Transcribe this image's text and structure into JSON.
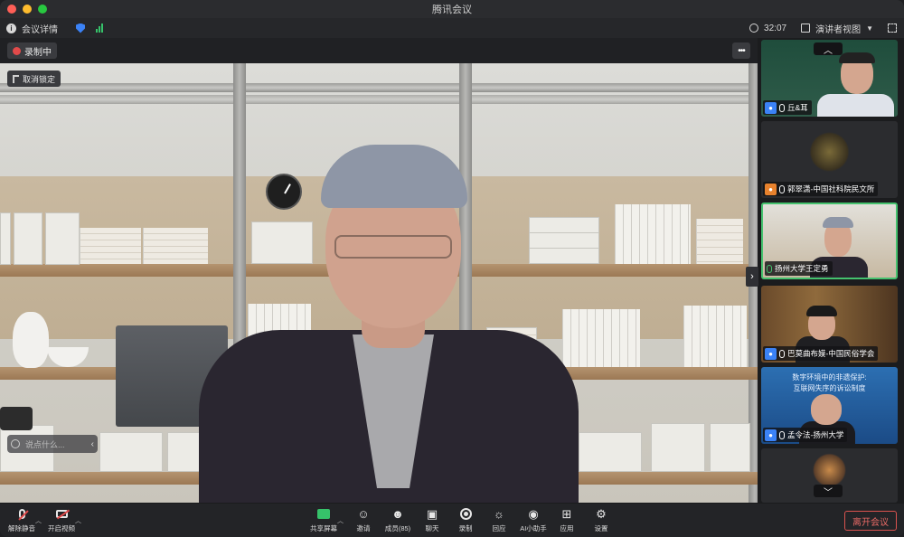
{
  "window": {
    "title": "腾讯会议"
  },
  "infobar": {
    "meeting_details": "会议详情",
    "timer": "32:07",
    "view_mode": "演讲者视图"
  },
  "main": {
    "recording_label": "录制中",
    "more_label": "•••",
    "unlock_label": "取消锁定",
    "chat_placeholder": "说点什么..."
  },
  "gallery": {
    "tiles": [
      {
        "name": "丘&耳"
      },
      {
        "name": "郭翠潇-中国社科院民文所"
      },
      {
        "name": "扬州大学王定勇"
      },
      {
        "name": "巴莫曲布嫫-中国民俗学会"
      },
      {
        "name": "孟令法-扬州大学"
      }
    ],
    "slide_line1": "数字环境中的非遗保护:",
    "slide_line2": "互联网失序的诉讼制度"
  },
  "toolbar": {
    "unmute": "解除静音",
    "start_video": "开启视频",
    "share_screen": "共享屏幕",
    "invite": "邀请",
    "members": "成员(85)",
    "chat": "聊天",
    "record": "录制",
    "playback": "回应",
    "ai_assistant": "AI小助手",
    "apps": "应用",
    "settings": "设置",
    "leave": "离开会议"
  },
  "colors": {
    "accent_green": "#36c26a",
    "recording_red": "#e24a4a",
    "leave_red": "#d9534f",
    "active_border": "#45c26e"
  }
}
